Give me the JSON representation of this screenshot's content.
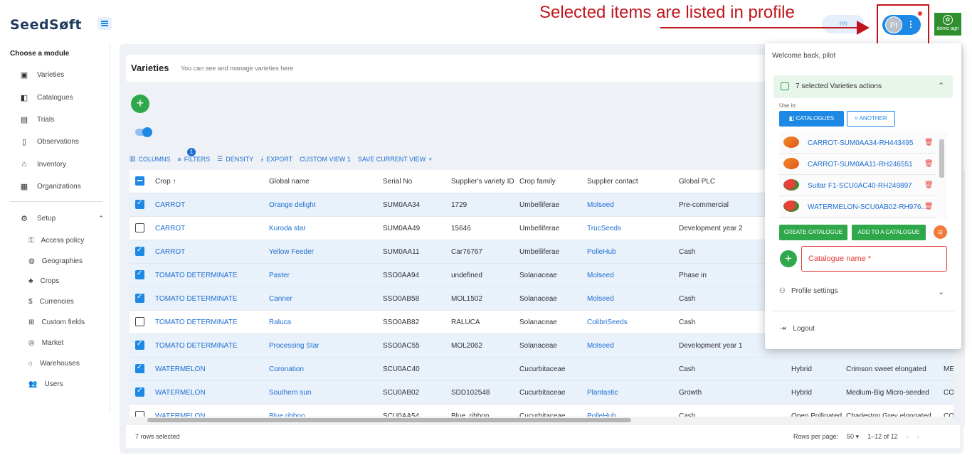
{
  "app": {
    "logo_text": "SeedSøft"
  },
  "annotation": {
    "text": "Selected items are listed in profile"
  },
  "header": {
    "lang": "en",
    "avatar_initials": "PI",
    "demo_label": "demo agri"
  },
  "sidebar": {
    "module_title": "Choose a module",
    "items": [
      {
        "label": "Varieties"
      },
      {
        "label": "Catalogues"
      },
      {
        "label": "Trials"
      },
      {
        "label": "Observations"
      },
      {
        "label": "Inventory"
      },
      {
        "label": "Organizations"
      }
    ],
    "setup_label": "Setup",
    "setup_items": [
      {
        "label": "Access policy"
      },
      {
        "label": "Geographies"
      },
      {
        "label": "Crops"
      },
      {
        "label": "Currencies"
      },
      {
        "label": "Custom fields"
      },
      {
        "label": "Market"
      },
      {
        "label": "Warehouses"
      },
      {
        "label": "Users"
      }
    ]
  },
  "page": {
    "title": "Varieties",
    "subtitle": "You can see and manage varieties here"
  },
  "toolbar": {
    "columns": "COLUMNS",
    "filters": "FILTERS",
    "filter_count": "1",
    "density": "DENSITY",
    "export": "EXPORT",
    "custom_view": "CUSTOM VIEW 1",
    "save_view": "SAVE CURRENT VIEW"
  },
  "table": {
    "columns": [
      "Crop ↑",
      "Global name",
      "Serial No",
      "Supplier's variety ID",
      "Crop family",
      "Supplier contact",
      "Global PLC"
    ],
    "rows": [
      {
        "selected": true,
        "crop": "CARROT",
        "name": "Orange delight",
        "serial": "SUM0AA34",
        "supplier_id": "1729",
        "family": "Umbelliferae",
        "contact": "Molseed",
        "plc": "Pre-commercial",
        "extra1": "",
        "extra2": "",
        "extra3": ""
      },
      {
        "selected": false,
        "crop": "CARROT",
        "name": "Kuroda star",
        "serial": "SUM0AA49",
        "supplier_id": "15646",
        "family": "Umbelliferae",
        "contact": "TrucSeeds",
        "plc": "Development year 2",
        "extra1": "",
        "extra2": "",
        "extra3": ""
      },
      {
        "selected": true,
        "crop": "CARROT",
        "name": "Yellow Feeder",
        "serial": "SUM0AA11",
        "supplier_id": "Car76767",
        "family": "Umbelliferae",
        "contact": "PolleHub",
        "plc": "Cash",
        "extra1": "",
        "extra2": "",
        "extra3": ""
      },
      {
        "selected": true,
        "crop": "TOMATO DETERMINATE",
        "name": "Paster",
        "serial": "SSO0AA94",
        "supplier_id": "undefined",
        "family": "Solanaceae",
        "contact": "Molseed",
        "plc": "Phase in",
        "extra1": "",
        "extra2": "",
        "extra3": ""
      },
      {
        "selected": true,
        "crop": "TOMATO DETERMINATE",
        "name": "Canner",
        "serial": "SSO0AB58",
        "supplier_id": "MOL1502",
        "family": "Solanaceae",
        "contact": "Molseed",
        "plc": "Cash",
        "extra1": "",
        "extra2": "",
        "extra3": ""
      },
      {
        "selected": false,
        "crop": "TOMATO DETERMINATE",
        "name": "Raluca",
        "serial": "SSO0AB82",
        "supplier_id": "RALUCA",
        "family": "Solanaceae",
        "contact": "ColibriSeeds",
        "plc": "Cash",
        "extra1": "",
        "extra2": "",
        "extra3": ""
      },
      {
        "selected": true,
        "crop": "TOMATO DETERMINATE",
        "name": "Processing Star",
        "serial": "SSO0AC55",
        "supplier_id": "MOL2062",
        "family": "Solanaceae",
        "contact": "Molseed",
        "plc": "Development year 1",
        "extra1": "",
        "extra2": "",
        "extra3": ""
      },
      {
        "selected": true,
        "crop": "WATERMELON",
        "name": "Coronation",
        "serial": "SCU0AC40",
        "supplier_id": "",
        "family": "Cucurbitaceae",
        "contact": "",
        "plc": "Cash",
        "extra1": "Hybrid",
        "extra2": "Crimson sweet elongated",
        "extra3": "ME"
      },
      {
        "selected": true,
        "crop": "WATERMELON",
        "name": "Southern sun",
        "serial": "SCU0AB02",
        "supplier_id": "SDD102548",
        "family": "Cucurbitaceae",
        "contact": "Plantastic",
        "plc": "Growth",
        "extra1": "Hybrid",
        "extra2": "Medium-Big Micro-seeded",
        "extra3": "CO"
      },
      {
        "selected": false,
        "crop": "WATERMELON",
        "name": "Blue ribbon",
        "serial": "SCU0AA54",
        "supplier_id": "Blue_ribbon",
        "family": "Cucurbitaceae",
        "contact": "PolleHub",
        "plc": "Cash",
        "extra1": "Open Pollinated",
        "extra2": "Charleston Grey elongated",
        "extra3": "CO"
      }
    ]
  },
  "footer": {
    "selected_text": "7 rows selected",
    "rows_per_page_label": "Rows per page:",
    "rows_per_page": "50",
    "range": "1–12 of 12"
  },
  "profile": {
    "welcome": "Welcome back,",
    "user": "pilot",
    "actions_title": "7 selected Varieties actions",
    "use_in": "Use in:",
    "btn_catalogues": "CATALOGUES",
    "btn_another": "ANOTHER",
    "selected_items": [
      {
        "name": "CARROT-SUM0AA34-RH443495",
        "kind": "carrot"
      },
      {
        "name": "CARROT-SUM0AA11-RH246551",
        "kind": "carrot"
      },
      {
        "name": "Suitar F1-SCU0AC40-RH249897",
        "kind": "watermelon"
      },
      {
        "name": "WATERMELON-SCU0AB02-RH976...",
        "kind": "watermelon"
      }
    ],
    "btn_create": "CREATE CATALOGUE",
    "btn_add": "ADD TO A CATALOGUE",
    "catalogue_placeholder": "Catalogue name *",
    "profile_settings": "Profile settings",
    "logout": "Logout"
  },
  "colors": {
    "accent": "#1e88e5",
    "green": "#2ea84a",
    "annotation": "#c0151b",
    "selected_row": "#e9f1fb"
  }
}
